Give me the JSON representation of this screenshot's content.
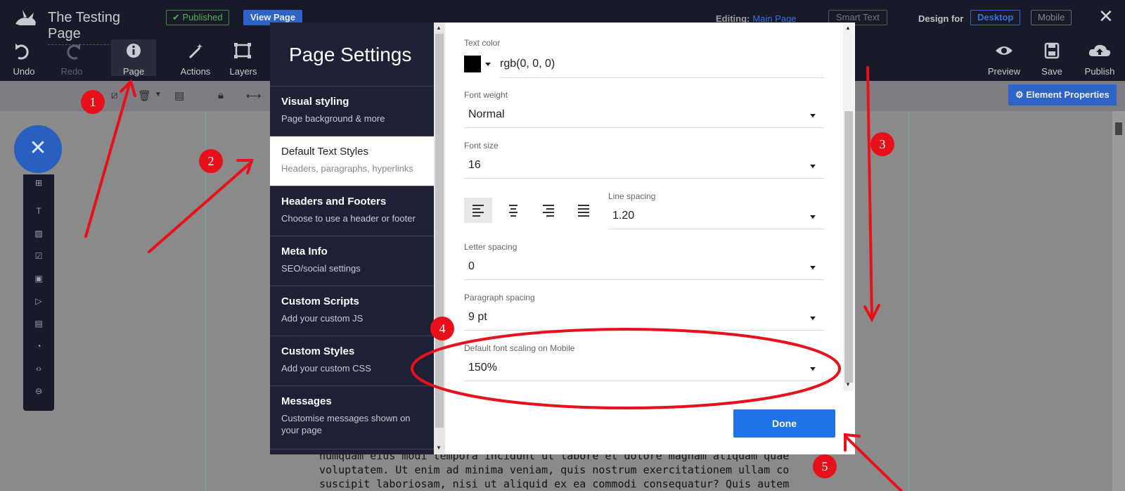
{
  "topbar": {
    "title": "The Testing Page",
    "published": "✔ Published",
    "view_page": "View Page",
    "editing_label": "Editing:",
    "editing_value": "Main Page",
    "smart_text": "Smart Text",
    "design_for": "Design for",
    "desktop": "Desktop",
    "mobile": "Mobile",
    "close": "✕"
  },
  "tools": {
    "undo": "Undo",
    "redo": "Redo",
    "page": "Page",
    "actions": "Actions",
    "layers": "Layers",
    "preview": "Preview",
    "save": "Save",
    "publish": "Publish"
  },
  "subbar": {
    "element_properties": "⚙ Element Properties"
  },
  "fab": {
    "label": "✕"
  },
  "modal": {
    "title": "Page Settings",
    "nav": [
      {
        "title": "Visual styling",
        "desc": "Page background & more"
      },
      {
        "title": "Default Text Styles",
        "desc": "Headers, paragraphs, hyperlinks"
      },
      {
        "title": "Headers and Footers",
        "desc": "Choose to use a header or footer"
      },
      {
        "title": "Meta Info",
        "desc": "SEO/social settings"
      },
      {
        "title": "Custom Scripts",
        "desc": "Add your custom JS"
      },
      {
        "title": "Custom Styles",
        "desc": "Add your custom CSS"
      },
      {
        "title": "Messages",
        "desc": "Customise messages shown on your page"
      }
    ],
    "fields": {
      "text_color_label": "Text color",
      "text_color_value": "rgb(0, 0, 0)",
      "font_weight_label": "Font weight",
      "font_weight_value": "Normal",
      "font_size_label": "Font size",
      "font_size_value": "16",
      "line_spacing_label": "Line spacing",
      "line_spacing_value": "1.20",
      "letter_spacing_label": "Letter spacing",
      "letter_spacing_value": "0",
      "paragraph_spacing_label": "Paragraph spacing",
      "paragraph_spacing_value": "9 pt",
      "mobile_scaling_label": "Default font scaling on Mobile",
      "mobile_scaling_value": "150%"
    },
    "done": "Done"
  },
  "page_text": [
    "numquam eius modi tempora incidunt ut labore et dolore magnam aliquam quaerat",
    "voluptatem. Ut enim ad minima veniam, quis nostrum exercitationem ullam corporis",
    "suscipit laboriosam, nisi ut aliquid ex ea commodi consequatur? Quis autem vel eum"
  ],
  "annotations": [
    "1",
    "2",
    "3",
    "4",
    "5"
  ],
  "colors": {
    "topbar": "#181a2a",
    "accent_blue": "#1f73e8",
    "annotation_red": "#e8101a"
  }
}
